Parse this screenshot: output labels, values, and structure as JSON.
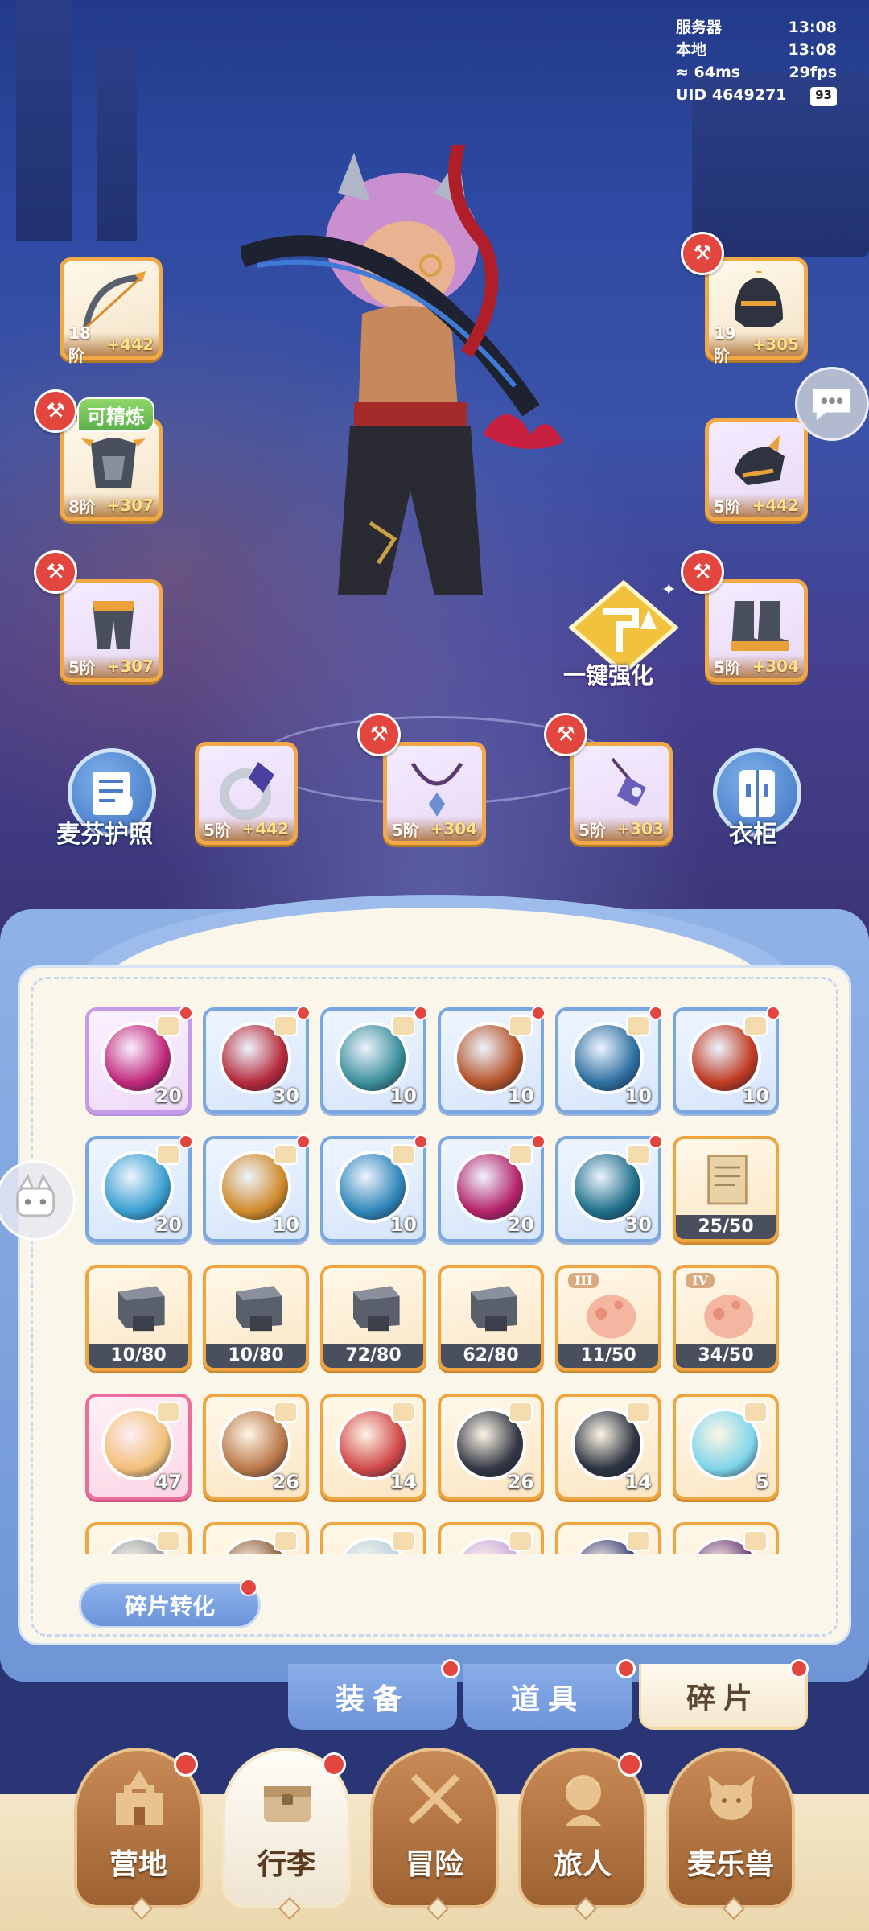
{
  "status": {
    "server_label": "服务器",
    "server_time": "13:08",
    "local_label": "本地",
    "local_time": "13:08",
    "ping": "64ms",
    "fps": "29fps",
    "uid": "UID 4649271",
    "battery": "93"
  },
  "equipment": {
    "bow": {
      "tier": "18阶",
      "bonus": "+442"
    },
    "helmet": {
      "tier": "19阶",
      "bonus": "+305"
    },
    "armor": {
      "tier": "8阶",
      "bonus": "+307",
      "tag": "可精炼"
    },
    "gauntlet": {
      "tier": "5阶",
      "bonus": "+442"
    },
    "leggings": {
      "tier": "5阶",
      "bonus": "+307"
    },
    "boots": {
      "tier": "5阶",
      "bonus": "+304"
    },
    "ring": {
      "tier": "5阶",
      "bonus": "+442"
    },
    "necklace": {
      "tier": "5阶",
      "bonus": "+304"
    },
    "charm": {
      "tier": "5阶",
      "bonus": "+303"
    }
  },
  "actions": {
    "passport": "麦芬护照",
    "wardrobe": "衣柜",
    "one_key_enhance": "一键强化"
  },
  "inventory": {
    "rows": [
      [
        {
          "count": "20",
          "style": "purple",
          "orb": "#c0287a"
        },
        {
          "count": "30",
          "style": "blue",
          "orb": "#b62a3a"
        },
        {
          "count": "10",
          "style": "blue",
          "orb": "#3a8f9a"
        },
        {
          "count": "10",
          "style": "blue",
          "orb": "#b5542a"
        },
        {
          "count": "10",
          "style": "blue",
          "orb": "#2d6fa0"
        },
        {
          "count": "10",
          "style": "blue",
          "orb": "#c03a22"
        }
      ],
      [
        {
          "count": "20",
          "style": "blue",
          "orb": "#3a9fd0"
        },
        {
          "count": "10",
          "style": "blue",
          "orb": "#d08a2a"
        },
        {
          "count": "10",
          "style": "blue",
          "orb": "#2e86b8"
        },
        {
          "count": "20",
          "style": "blue",
          "orb": "#b5236a"
        },
        {
          "count": "30",
          "style": "blue",
          "orb": "#1f6f8a"
        },
        {
          "bar": "25/50",
          "style": "orange",
          "kind": "scroll"
        }
      ],
      [
        {
          "bar": "10/80",
          "style": "orange",
          "kind": "anvil"
        },
        {
          "bar": "10/80",
          "style": "orange",
          "kind": "anvil"
        },
        {
          "bar": "72/80",
          "style": "orange",
          "kind": "anvil"
        },
        {
          "bar": "62/80",
          "style": "orange",
          "kind": "anvil"
        },
        {
          "bar": "11/50",
          "style": "orange",
          "kind": "hand",
          "roman": "III"
        },
        {
          "bar": "34/50",
          "style": "orange",
          "kind": "hand",
          "roman": "IV"
        }
      ],
      [
        {
          "count": "47",
          "style": "pink",
          "orb": "#f2c07a"
        },
        {
          "count": "26",
          "style": "orange",
          "orb": "#b9784a"
        },
        {
          "count": "14",
          "style": "orange",
          "orb": "#d04848"
        },
        {
          "count": "26",
          "style": "orange",
          "orb": "#333845"
        },
        {
          "count": "14",
          "style": "orange",
          "orb": "#2c3340"
        },
        {
          "count": "5",
          "style": "orange",
          "orb": "#7fd6ea"
        }
      ],
      [
        {
          "count": "",
          "style": "orange",
          "orb": "#9aa0aa"
        },
        {
          "count": "",
          "style": "orange",
          "orb": "#8a5a3a"
        },
        {
          "count": "",
          "style": "orange",
          "orb": "#b7d0e0"
        },
        {
          "count": "",
          "style": "orange",
          "orb": "#c9a9e0"
        },
        {
          "count": "",
          "style": "orange",
          "orb": "#3a3f7a"
        },
        {
          "count": "",
          "style": "orange",
          "orb": "#6a3a7a"
        }
      ]
    ],
    "convert_button": "碎片转化"
  },
  "subtabs": [
    {
      "label": "装备",
      "active": false
    },
    {
      "label": "道具",
      "active": false
    },
    {
      "label": "碎片",
      "active": true
    }
  ],
  "nav": [
    {
      "label": "营地",
      "active": false,
      "icon": "castle-icon"
    },
    {
      "label": "行李",
      "active": true,
      "icon": "chest-icon"
    },
    {
      "label": "冒险",
      "active": false,
      "icon": "crossed-swords-icon"
    },
    {
      "label": "旅人",
      "active": false,
      "icon": "traveler-icon"
    },
    {
      "label": "麦乐兽",
      "active": false,
      "icon": "pet-icon"
    }
  ]
}
